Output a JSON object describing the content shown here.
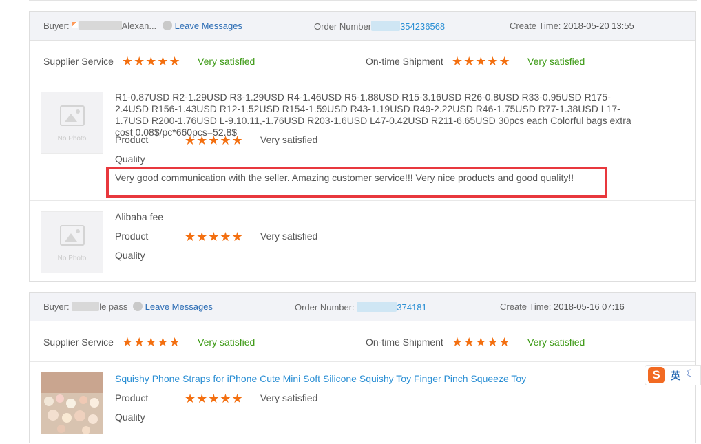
{
  "orders": [
    {
      "buyer_label": "Buyer:",
      "buyer_name": "Alexan...",
      "leave_messages": "Leave Messages",
      "order_number_label": "Order Number",
      "order_number": "354236568",
      "create_time_label": "Create Time:",
      "create_time": "2018-05-20 13:55",
      "supplier_service_label": "Supplier Service",
      "supplier_service_stars": 5,
      "supplier_service_text": "Very satisfied",
      "shipment_label": "On-time Shipment",
      "shipment_stars": 5,
      "shipment_text": "Very satisfied",
      "products": [
        {
          "thumb_text": "No Photo",
          "title": "R1-0.87USD R2-1.29USD R3-1.29USD R4-1.46USD R5-1.88USD R15-3.16USD R26-0.8USD R33-0.95USD R175-2.4USD R156-1.43USD R12-1.52USD R154-1.59USD R43-1.19USD R49-2.22USD R46-1.75USD R77-1.38USD L17-1.7USD R200-1.76USD L-9.10.11,-1.76USD R203-1.6USD L47-0.42USD R211-6.65USD 30pcs each Colorful bags extra cost 0.08$/pc*660pcs=52.8$",
          "product_label": "Product",
          "quality_label": "Quality",
          "stars": 5,
          "rating_text": "Very satisfied",
          "comment": "Very good communication with the seller. Amazing customer service!!! Very nice products and good quality!!"
        },
        {
          "thumb_text": "No Photo",
          "title": "Alibaba fee",
          "product_label": "Product",
          "quality_label": "Quality",
          "stars": 5,
          "rating_text": "Very satisfied"
        }
      ]
    },
    {
      "buyer_label": "Buyer:",
      "buyer_name": "le pass",
      "leave_messages": "Leave Messages",
      "order_number_label": "Order Number:",
      "order_number": "374181",
      "create_time_label": "Create Time:",
      "create_time": "2018-05-16 07:16",
      "supplier_service_label": "Supplier Service",
      "supplier_service_stars": 5,
      "supplier_service_text": "Very satisfied",
      "shipment_label": "On-time Shipment",
      "shipment_stars": 5,
      "shipment_text": "Very satisfied",
      "products": [
        {
          "title": "Squishy Phone Straps for iPhone Cute Mini Soft Silicone Squishy Toy Finger Pinch Squeeze Toy",
          "product_label": "Product",
          "quality_label": "Quality",
          "stars": 5,
          "rating_text": "Very satisfied"
        }
      ]
    }
  ],
  "ime": {
    "brand": "S",
    "lang": "英"
  },
  "colors": {
    "star": "#f36f10",
    "satisfied": "#3d9a15",
    "link": "#2b6cb4",
    "highlight_box": "#e8383d"
  }
}
